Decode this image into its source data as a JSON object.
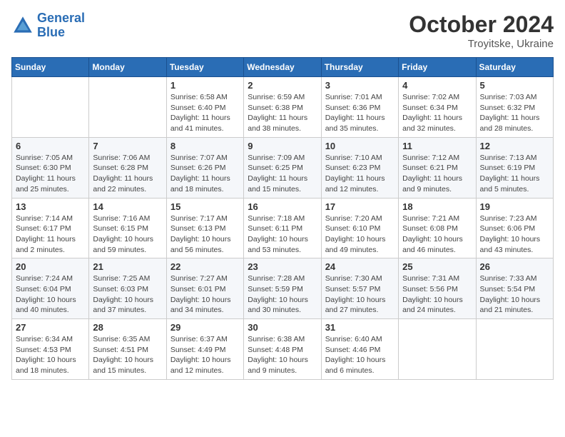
{
  "logo": {
    "line1": "General",
    "line2": "Blue"
  },
  "title": "October 2024",
  "location": "Troyitske, Ukraine",
  "days_of_week": [
    "Sunday",
    "Monday",
    "Tuesday",
    "Wednesday",
    "Thursday",
    "Friday",
    "Saturday"
  ],
  "weeks": [
    [
      {
        "day": "",
        "info": ""
      },
      {
        "day": "",
        "info": ""
      },
      {
        "day": "1",
        "info": "Sunrise: 6:58 AM\nSunset: 6:40 PM\nDaylight: 11 hours and 41 minutes."
      },
      {
        "day": "2",
        "info": "Sunrise: 6:59 AM\nSunset: 6:38 PM\nDaylight: 11 hours and 38 minutes."
      },
      {
        "day": "3",
        "info": "Sunrise: 7:01 AM\nSunset: 6:36 PM\nDaylight: 11 hours and 35 minutes."
      },
      {
        "day": "4",
        "info": "Sunrise: 7:02 AM\nSunset: 6:34 PM\nDaylight: 11 hours and 32 minutes."
      },
      {
        "day": "5",
        "info": "Sunrise: 7:03 AM\nSunset: 6:32 PM\nDaylight: 11 hours and 28 minutes."
      }
    ],
    [
      {
        "day": "6",
        "info": "Sunrise: 7:05 AM\nSunset: 6:30 PM\nDaylight: 11 hours and 25 minutes."
      },
      {
        "day": "7",
        "info": "Sunrise: 7:06 AM\nSunset: 6:28 PM\nDaylight: 11 hours and 22 minutes."
      },
      {
        "day": "8",
        "info": "Sunrise: 7:07 AM\nSunset: 6:26 PM\nDaylight: 11 hours and 18 minutes."
      },
      {
        "day": "9",
        "info": "Sunrise: 7:09 AM\nSunset: 6:25 PM\nDaylight: 11 hours and 15 minutes."
      },
      {
        "day": "10",
        "info": "Sunrise: 7:10 AM\nSunset: 6:23 PM\nDaylight: 11 hours and 12 minutes."
      },
      {
        "day": "11",
        "info": "Sunrise: 7:12 AM\nSunset: 6:21 PM\nDaylight: 11 hours and 9 minutes."
      },
      {
        "day": "12",
        "info": "Sunrise: 7:13 AM\nSunset: 6:19 PM\nDaylight: 11 hours and 5 minutes."
      }
    ],
    [
      {
        "day": "13",
        "info": "Sunrise: 7:14 AM\nSunset: 6:17 PM\nDaylight: 11 hours and 2 minutes."
      },
      {
        "day": "14",
        "info": "Sunrise: 7:16 AM\nSunset: 6:15 PM\nDaylight: 10 hours and 59 minutes."
      },
      {
        "day": "15",
        "info": "Sunrise: 7:17 AM\nSunset: 6:13 PM\nDaylight: 10 hours and 56 minutes."
      },
      {
        "day": "16",
        "info": "Sunrise: 7:18 AM\nSunset: 6:11 PM\nDaylight: 10 hours and 53 minutes."
      },
      {
        "day": "17",
        "info": "Sunrise: 7:20 AM\nSunset: 6:10 PM\nDaylight: 10 hours and 49 minutes."
      },
      {
        "day": "18",
        "info": "Sunrise: 7:21 AM\nSunset: 6:08 PM\nDaylight: 10 hours and 46 minutes."
      },
      {
        "day": "19",
        "info": "Sunrise: 7:23 AM\nSunset: 6:06 PM\nDaylight: 10 hours and 43 minutes."
      }
    ],
    [
      {
        "day": "20",
        "info": "Sunrise: 7:24 AM\nSunset: 6:04 PM\nDaylight: 10 hours and 40 minutes."
      },
      {
        "day": "21",
        "info": "Sunrise: 7:25 AM\nSunset: 6:03 PM\nDaylight: 10 hours and 37 minutes."
      },
      {
        "day": "22",
        "info": "Sunrise: 7:27 AM\nSunset: 6:01 PM\nDaylight: 10 hours and 34 minutes."
      },
      {
        "day": "23",
        "info": "Sunrise: 7:28 AM\nSunset: 5:59 PM\nDaylight: 10 hours and 30 minutes."
      },
      {
        "day": "24",
        "info": "Sunrise: 7:30 AM\nSunset: 5:57 PM\nDaylight: 10 hours and 27 minutes."
      },
      {
        "day": "25",
        "info": "Sunrise: 7:31 AM\nSunset: 5:56 PM\nDaylight: 10 hours and 24 minutes."
      },
      {
        "day": "26",
        "info": "Sunrise: 7:33 AM\nSunset: 5:54 PM\nDaylight: 10 hours and 21 minutes."
      }
    ],
    [
      {
        "day": "27",
        "info": "Sunrise: 6:34 AM\nSunset: 4:53 PM\nDaylight: 10 hours and 18 minutes."
      },
      {
        "day": "28",
        "info": "Sunrise: 6:35 AM\nSunset: 4:51 PM\nDaylight: 10 hours and 15 minutes."
      },
      {
        "day": "29",
        "info": "Sunrise: 6:37 AM\nSunset: 4:49 PM\nDaylight: 10 hours and 12 minutes."
      },
      {
        "day": "30",
        "info": "Sunrise: 6:38 AM\nSunset: 4:48 PM\nDaylight: 10 hours and 9 minutes."
      },
      {
        "day": "31",
        "info": "Sunrise: 6:40 AM\nSunset: 4:46 PM\nDaylight: 10 hours and 6 minutes."
      },
      {
        "day": "",
        "info": ""
      },
      {
        "day": "",
        "info": ""
      }
    ]
  ]
}
